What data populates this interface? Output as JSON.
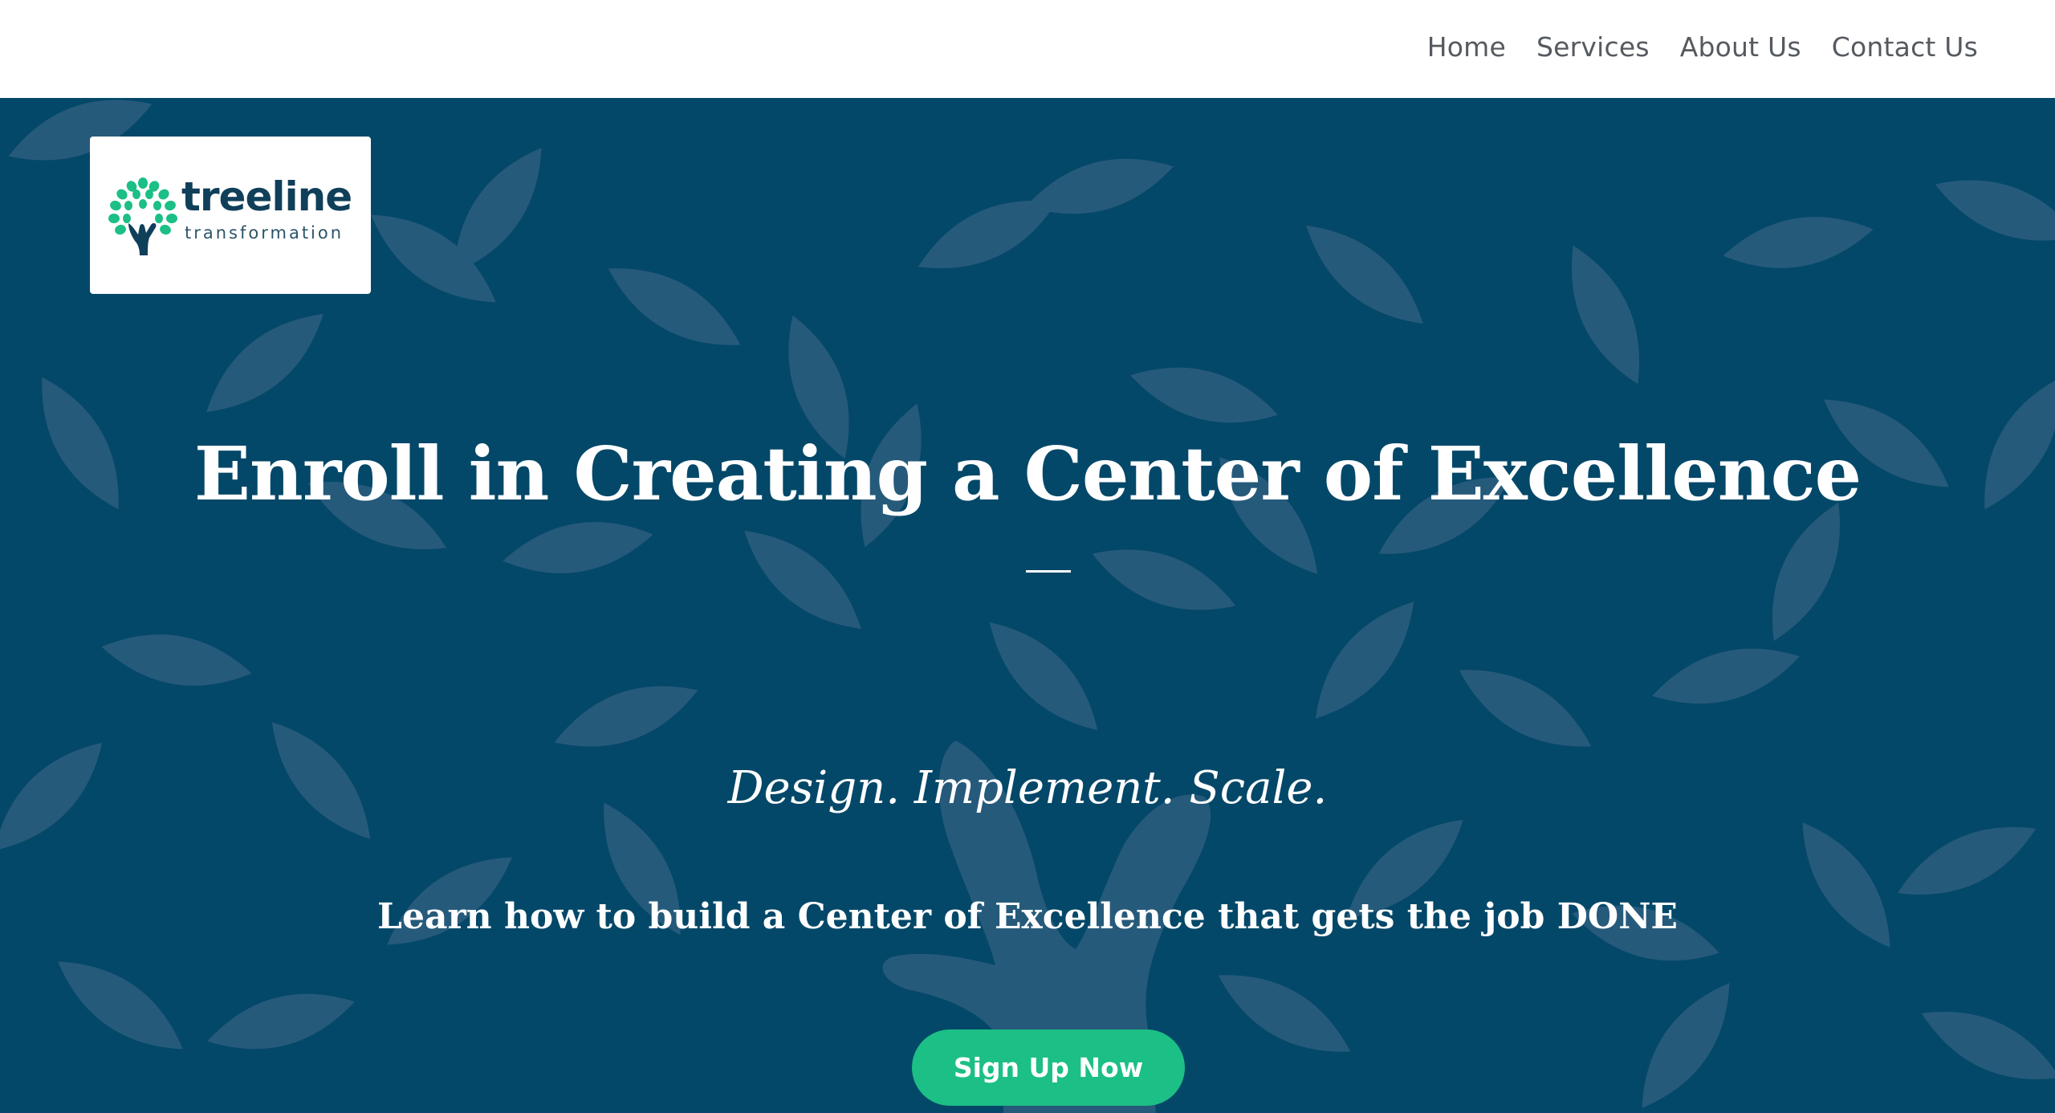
{
  "nav": {
    "items": [
      {
        "label": "Home"
      },
      {
        "label": "Services"
      },
      {
        "label": "About Us"
      },
      {
        "label": "Contact Us"
      }
    ]
  },
  "logo": {
    "wordmark": "treeline",
    "subtext": "transformation",
    "icon": "tree-hand-icon",
    "colors": {
      "leaf": "#1cbf85",
      "text": "#103f5a"
    }
  },
  "hero": {
    "headline": "Enroll in Creating a Center of Excellence",
    "tagline": "Design. Implement. Scale.",
    "subheading": "Learn how to build a Center of Excellence that gets the job DONE",
    "cta_label": "Sign Up Now",
    "colors": {
      "background": "#044869",
      "leaf_pattern": "#265a7b",
      "cta": "#1cbf85"
    }
  }
}
